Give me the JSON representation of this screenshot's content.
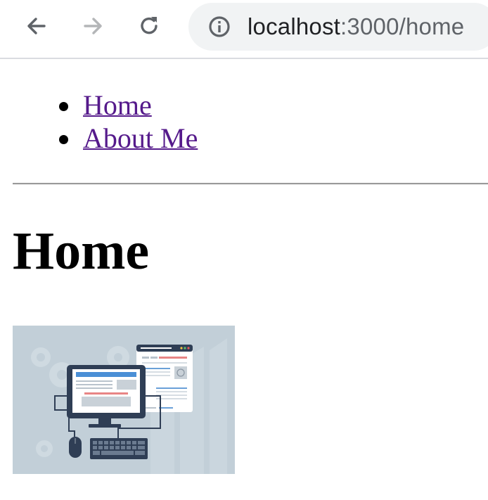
{
  "browser": {
    "url_host": "localhost",
    "url_rest": ":3000/home",
    "icons": {
      "back": "back-arrow-icon",
      "forward": "forward-arrow-icon",
      "reload": "reload-icon",
      "info": "info-icon"
    },
    "colors": {
      "omnibox_bg": "#f1f3f4",
      "icon_active": "#5f6368",
      "icon_disabled": "#b4b6b8"
    }
  },
  "nav": {
    "items": [
      {
        "label": "Home"
      },
      {
        "label": "About Me"
      }
    ],
    "link_color": "#551a8b"
  },
  "page": {
    "title": "Home"
  },
  "hero_image": {
    "icon": "computer-workstation-illustration",
    "bg_color": "#c2cfd8"
  }
}
